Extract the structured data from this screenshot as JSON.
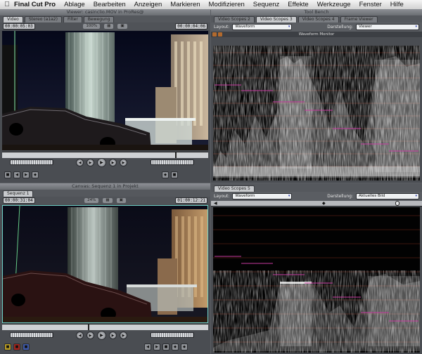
{
  "menubar": {
    "app_name": "Final Cut Pro",
    "items": [
      "Ablage",
      "Bearbeiten",
      "Anzeigen",
      "Markieren",
      "Modifizieren",
      "Sequenz",
      "Effekte",
      "Werkzeuge",
      "Fenster",
      "Hilfe"
    ]
  },
  "viewer": {
    "title": "Viewer: casinclio.MOV in ProRes@",
    "tabs": [
      "Video",
      "Stereo (a1a2)",
      "Filter",
      "Bewegung"
    ],
    "timecode_left": "00:00:05:03",
    "timecode_right": "00:00:04:06",
    "zoom": "100%"
  },
  "canvas": {
    "title": "Canvas: Sequenz 1 in Projekt",
    "tabs": [
      "Sequenz 1"
    ],
    "timecode_left": "00:00:31:04",
    "timecode_right": "01:00:12:21",
    "zoom": "24%"
  },
  "scope_top": {
    "title": "Tool Bench",
    "tabs": [
      "Video Scopes 2",
      "Video Scopes 3",
      "Video Scopes 4",
      "Frame Viewer"
    ],
    "layout_label": "Layout:",
    "layout_value": "Waveform",
    "display_label": "Darstellung:",
    "display_value": "Viewer",
    "header": "Waveform Monitor"
  },
  "scope_bottom": {
    "tabs": [
      "Video Scopes 5"
    ],
    "layout_label": "Layout:",
    "layout_value": "Waveform",
    "display_label": "Darstellung:",
    "display_value": "Aktuelles Bild"
  },
  "colors": {
    "waveform_guides": "#c83aa0",
    "selection_border": "#6ed1c8"
  }
}
